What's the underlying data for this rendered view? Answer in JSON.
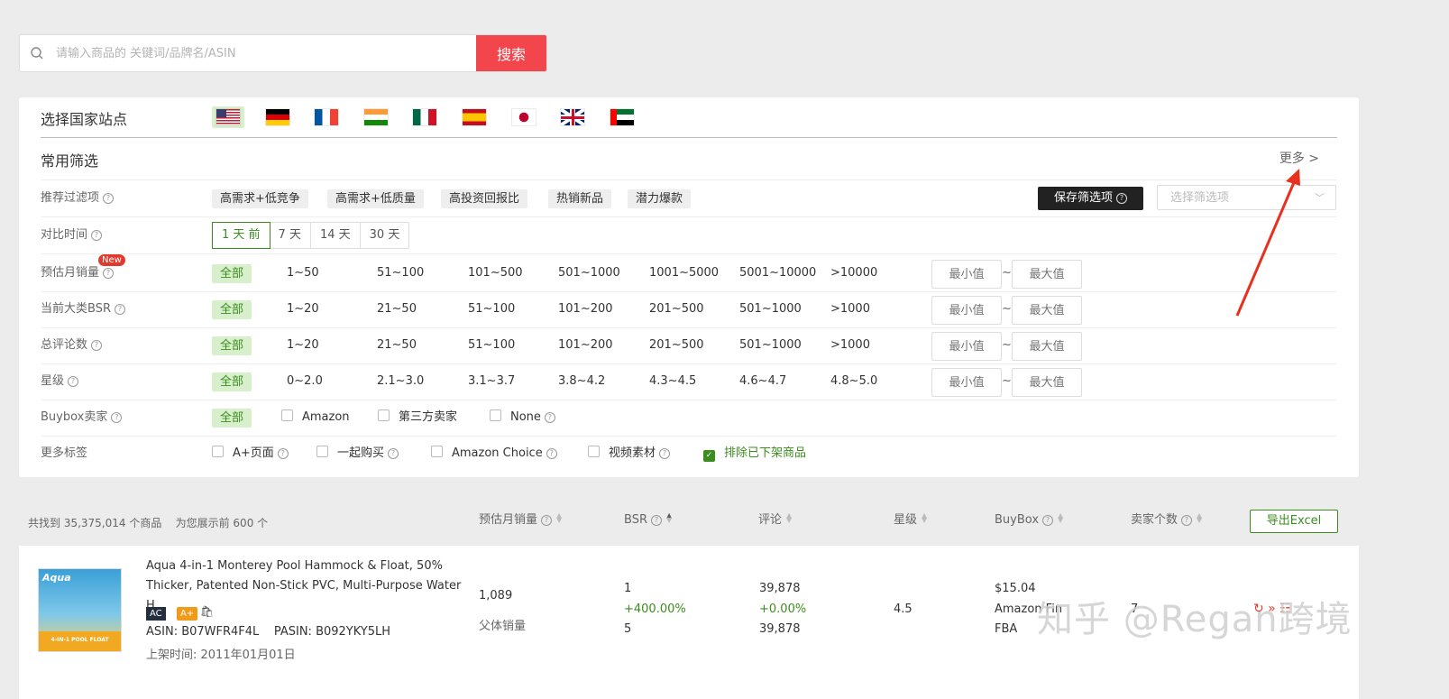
{
  "search": {
    "placeholder": "请输入商品的 关键词/品牌名/ASIN",
    "button_label": "搜索"
  },
  "country": {
    "title": "选择国家站点",
    "flags": [
      {
        "name": "us",
        "selected": true
      },
      {
        "name": "de"
      },
      {
        "name": "fr"
      },
      {
        "name": "in"
      },
      {
        "name": "mx"
      },
      {
        "name": "es"
      },
      {
        "name": "jp"
      },
      {
        "name": "uk"
      },
      {
        "name": "ae"
      }
    ]
  },
  "common": {
    "title": "常用筛选",
    "more": "更多 >"
  },
  "recommend": {
    "label": "推荐过滤项",
    "tags": [
      "高需求+低竞争",
      "高需求+低质量",
      "高投资回报比",
      "热销新品",
      "潜力爆款"
    ],
    "save_label": "保存筛选项",
    "select_placeholder": "选择筛选项"
  },
  "compare": {
    "label": "对比时间",
    "options": [
      "1 天 前",
      "7 天",
      "14 天",
      "30 天"
    ],
    "active": "1 天 前"
  },
  "sales": {
    "label": "预估月销量",
    "badge": "New",
    "all": "全部",
    "options": [
      "1~50",
      "51~100",
      "101~500",
      "501~1000",
      "1001~5000",
      "5001~10000",
      ">10000"
    ]
  },
  "bsr": {
    "label": "当前大类BSR",
    "all": "全部",
    "options": [
      "1~20",
      "21~50",
      "51~100",
      "101~200",
      "201~500",
      "501~1000",
      ">1000"
    ]
  },
  "reviews": {
    "label": "总评论数",
    "all": "全部",
    "options": [
      "1~20",
      "21~50",
      "51~100",
      "101~200",
      "201~500",
      "501~1000",
      ">1000"
    ]
  },
  "rating": {
    "label": "星级",
    "all": "全部",
    "options": [
      "0~2.0",
      "2.1~3.0",
      "3.1~3.7",
      "3.8~4.2",
      "4.3~4.5",
      "4.6~4.7",
      "4.8~5.0"
    ]
  },
  "range": {
    "min": "最小值",
    "max": "最大值",
    "sep": "~"
  },
  "buybox": {
    "label": "Buybox卖家",
    "all": "全部",
    "options": [
      "Amazon",
      "第三方卖家",
      "None"
    ]
  },
  "more_tags": {
    "label": "更多标签",
    "options": [
      "A+页面",
      "一起购买",
      "Amazon Choice",
      "视频素材"
    ],
    "checked": "排除已下架商品"
  },
  "results": {
    "count_text": "共找到 35,375,014 个商品",
    "shown_text": "为您展示前 600 个",
    "columns": [
      "预估月销量",
      "BSR",
      "评论",
      "星级",
      "BuyBox",
      "卖家个数"
    ],
    "export": "导出Excel"
  },
  "product": {
    "title": "Aqua 4-in-1 Monterey Pool Hammock & Float, 50% Thicker, Patented Non-Stick PVC, Multi-Purpose Water H...",
    "thumb_brand": "Aqua",
    "thumb_label": "4-IN-1 POOL FLOAT",
    "badge_ac": "AC",
    "badge_aplus": "A+",
    "asin": "ASIN: B07WFR4F4L",
    "pasin": "PASIN: B092YKY5LH",
    "listed": "上架时间: 2011年01月01日",
    "sales": "1,089",
    "sales_sub": "父体销量",
    "bsr": "1",
    "bsr_change": "+400.00%",
    "bsr_prev": "5",
    "reviews": "39,878",
    "reviews_change": "+0.00%",
    "reviews_prev": "39,878",
    "rating": "4.5",
    "price": "$15.04",
    "seller": "Amazon Fin",
    "fulfil": "FBA",
    "seller_count": "7"
  },
  "watermark": "知乎 @Regan跨境",
  "colors": {
    "accent_red": "#f2464c",
    "accent_green": "#3b8d1e"
  }
}
